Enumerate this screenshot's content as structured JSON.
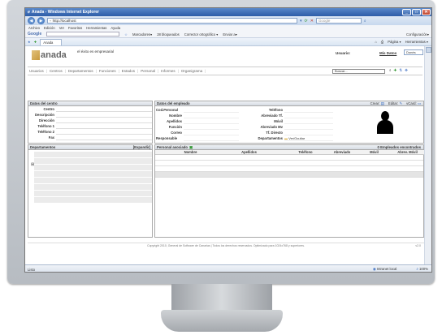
{
  "browser": {
    "title": "Anada - Windows Internet Explorer",
    "address": "http://localhost",
    "search_placeholder": "Google",
    "menu": [
      "Archivo",
      "Edición",
      "Ver",
      "Favoritos",
      "Herramientas",
      "Ayuda"
    ],
    "google_label": "Google",
    "google_items": [
      "Marcadores▾",
      "28 bloqueados",
      "Corrector ortográfico ▾",
      "Enviar a▾"
    ],
    "google_config": "Configuración▾",
    "tab_label": "Anada",
    "tab_tools": [
      "Página ▾",
      "Herramientas ▾"
    ],
    "status_left": "Listo",
    "status_zone": "Intranet local",
    "zoom": "100%"
  },
  "app": {
    "logo": "anada",
    "logo_sub": "el éxito es empresarial",
    "usuario_label": "Usuario:",
    "mis_datos": "Mis Datos",
    "language": "Donés",
    "nav": [
      "Usuarios",
      "Centros",
      "Departamentos",
      "Funciones",
      "Estados",
      "Personal",
      "Informes",
      "Organigrama"
    ],
    "search_value": "Buscar..."
  },
  "centro": {
    "title": "Datos del centro",
    "fields": [
      "Centro",
      "Descripción",
      "Dirección",
      "Teléfono 1",
      "Teléfono 2",
      "Fax"
    ]
  },
  "empleado": {
    "title": "Datos del empleado",
    "actions": [
      "Crear:",
      "Editar:",
      "vCard:"
    ],
    "left_fields": [
      "Cod.Personal",
      "Nombre",
      "Apellidos",
      "Función",
      "Correo",
      "Responsable"
    ],
    "right_fields": [
      "Teléfono",
      "Abreviado Tf.",
      "Móvil",
      "Abreviado Mv",
      "Tf. Directo",
      "Departamentos"
    ],
    "show_hide": "Ver/Ocultar"
  },
  "departamentos": {
    "title": "Departamentos",
    "expand": "[Expandir]"
  },
  "personal": {
    "title": "Personal asociado",
    "count": "0 Empleados encontrados",
    "columns": [
      "Nombre",
      "Apellidos",
      "Teléfono",
      "Abreviado",
      "Móvil",
      "Abrev. Móvil"
    ]
  },
  "footer": {
    "copyright": "Copyright 2010, General de Software de Canarias | Todos los derechos reservados. Optimizado para 1024x768 y superiores.",
    "version": "v2.0"
  }
}
